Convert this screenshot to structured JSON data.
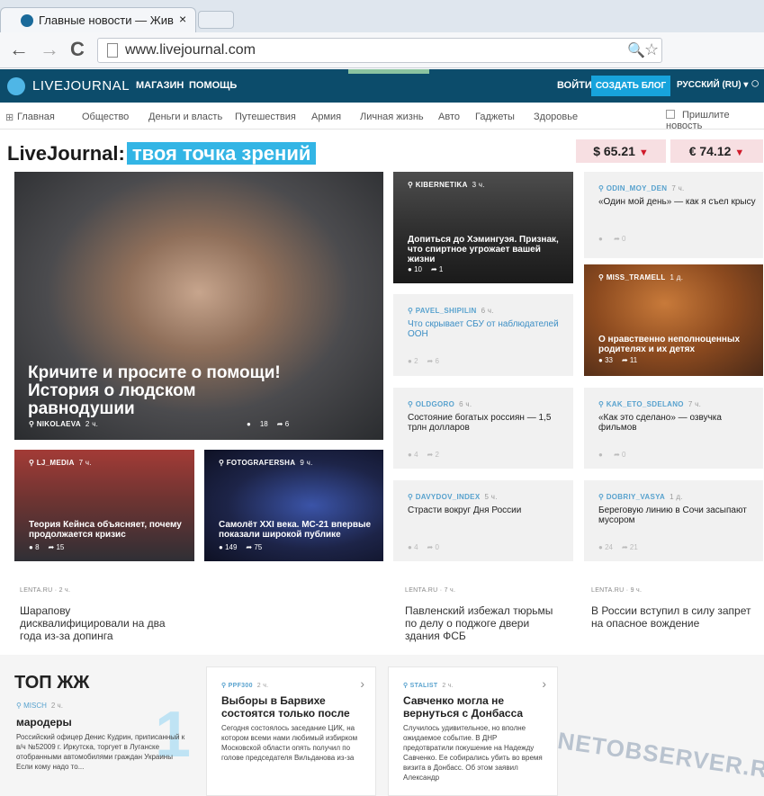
{
  "browser": {
    "tab_title": "Главные новости — Живой",
    "tab_close": "×",
    "url": "www.livejournal.com",
    "nav_back": "←",
    "nav_forward": "→",
    "reload": "C",
    "zoom_icon": "🔍",
    "star_icon": "☆"
  },
  "header": {
    "logo": "LIVEJOURNAL",
    "nav": [
      "МАГАЗИН",
      "ПОМОЩЬ"
    ],
    "login": "ВОЙТИ",
    "create": "СОЗДАТЬ БЛОГ",
    "lang": "РУССКИЙ (RU) ▾",
    "search_icon": "○"
  },
  "categories": [
    "Главная",
    "Общество",
    "Деньги и власть",
    "Путешествия",
    "Армия",
    "Личная жизнь",
    "Авто",
    "Гаджеты",
    "Здоровье"
  ],
  "suggest": "Пришлите новость",
  "tagline": {
    "brand": "LiveJournal:",
    "highlight": "твоя точка зрений"
  },
  "currency": [
    {
      "value": "$ 65.21"
    },
    {
      "value": "€ 74.12"
    }
  ],
  "hero": {
    "title": "Кричите и просите о помощи! История о людском равнодушии",
    "author": "NIKOLAEVA",
    "time": "2 ч.",
    "comments": "18",
    "reposts": "6"
  },
  "photo_cards": {
    "lj_media": {
      "author": "LJ_MEDIA",
      "time": "7 ч.",
      "title": "Теория Кейнса объясняет, почему продолжается кризис",
      "comments": "8",
      "reposts": "15"
    },
    "fotografersha": {
      "author": "FOTOGRAFERSHA",
      "time": "9 ч.",
      "title": "Самолёт XXI века. МС-21 впервые показали широкой публике",
      "comments": "149",
      "reposts": "75"
    },
    "kibernetika": {
      "author": "KIBERNETIKA",
      "time": "3 ч.",
      "title": "Допиться до Хэмингуэя. Признак, что спиртное угрожает вашей жизни",
      "comments": "10",
      "reposts": "1"
    },
    "miss_tramell": {
      "author": "MISS_TRAMELL",
      "time": "1 д.",
      "title": "О нравственно неполноценных родителях и их детях",
      "comments": "33",
      "reposts": "11"
    }
  },
  "gray_cards": {
    "odin": {
      "author": "ODIN_MOY_DEN",
      "time": "7 ч.",
      "title": "«Один мой день» — как я съел крысу",
      "comments": "",
      "reposts": "0"
    },
    "pavel": {
      "author": "PAVEL_SHIPILIN",
      "time": "6 ч.",
      "title": "Что скрывает СБУ от наблюдателей ООН",
      "comments": "2",
      "reposts": "6"
    },
    "oldgoro": {
      "author": "OLDGORO",
      "time": "6 ч.",
      "title": "Состояние богатых россиян — 1,5 трлн долларов",
      "comments": "4",
      "reposts": "2"
    },
    "kak": {
      "author": "KAK_ETO_SDELANO",
      "time": "7 ч.",
      "title": "«Как это сделано» — озвучка фильмов",
      "comments": "",
      "reposts": "0"
    },
    "davydov": {
      "author": "DAVYDOV_INDEX",
      "time": "5 ч.",
      "title": "Страсти вокруг Дня России",
      "comments": "4",
      "reposts": "0"
    },
    "dobriy": {
      "author": "DOBRIY_VASYA",
      "time": "1 д.",
      "title": "Береговую линию в Сочи засыпают мусором",
      "comments": "24",
      "reposts": "21"
    }
  },
  "news": [
    {
      "src": "LENTA.RU · 2 ч.",
      "text": "Шарапову дисквалифицировали на два года из-за допинга"
    },
    {
      "src": "LENTA.RU · 7 ч.",
      "text": "Павленский избежал тюрьмы по делу о поджоге двери здания ФСБ"
    },
    {
      "src": "LENTA.RU · 9 ч.",
      "text": "В России вступил в силу запрет на опасное вождение"
    }
  ],
  "top": {
    "title": "ТОП ЖЖ",
    "rank": "1",
    "author": "MISCH",
    "time": "2 ч.",
    "head": "мародеры",
    "body": "Российский офицер Денис Кудрин, приписанный к в/ч №52009 г. Иркутска, торгует в Луганске отобранными автомобилями граждан Украины Если кому надо то..."
  },
  "top_cards": [
    {
      "author": "PPF300",
      "time": "2 ч.",
      "head": "Выборы в Барвихе состоятся только после",
      "body": "Сегодня состоялось заседание ЦИК, на котором всеми нами любимый избирком Московской области опять получил по голове председателя Вильданова из-за"
    },
    {
      "author": "STALIST",
      "time": "2 ч.",
      "head": "Савченко могла не вернуться с Донбасса",
      "body": "Случилось удивительное, но вполне ожидаемое событие. В ДНР предотвратили покушение на Надежду Савченко. Ее собирались убить во время визита в Донбасс. Об этом заявил Александр"
    }
  ],
  "watermark": "NETOBSERVER.RU",
  "colors": {
    "header_bg": "#0c4c6b",
    "accent": "#33b5e5",
    "currency_bg": "#f7dfe2",
    "down_arrow": "#d01a2a"
  }
}
